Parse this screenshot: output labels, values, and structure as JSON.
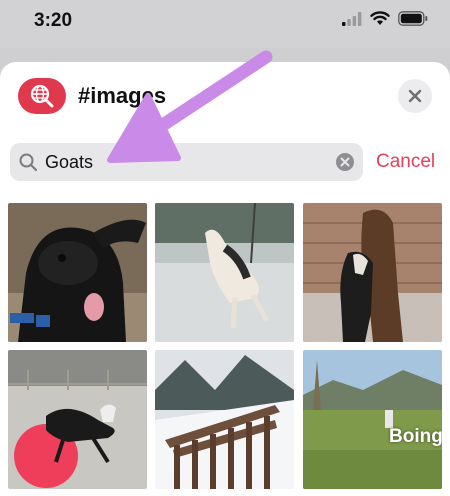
{
  "status_bar": {
    "time": "3:20"
  },
  "sheet": {
    "title": "#images",
    "app_icon": "globe-search-icon",
    "close_icon": "close-icon"
  },
  "search": {
    "value": "Goats",
    "search_icon": "search-icon",
    "clear_icon": "clear-icon",
    "cancel_label": "Cancel"
  },
  "results": [
    {
      "name": "gif-black-goat-tongue"
    },
    {
      "name": "gif-goat-jumping-snow"
    },
    {
      "name": "gif-llama-and-goat"
    },
    {
      "name": "gif-goat-on-ball"
    },
    {
      "name": "gif-wooden-fence-snow"
    },
    {
      "name": "gif-goat-boing-field",
      "caption": "Boing"
    }
  ],
  "colors": {
    "accent": "#e4405a",
    "arrow": "#c98ae8"
  }
}
